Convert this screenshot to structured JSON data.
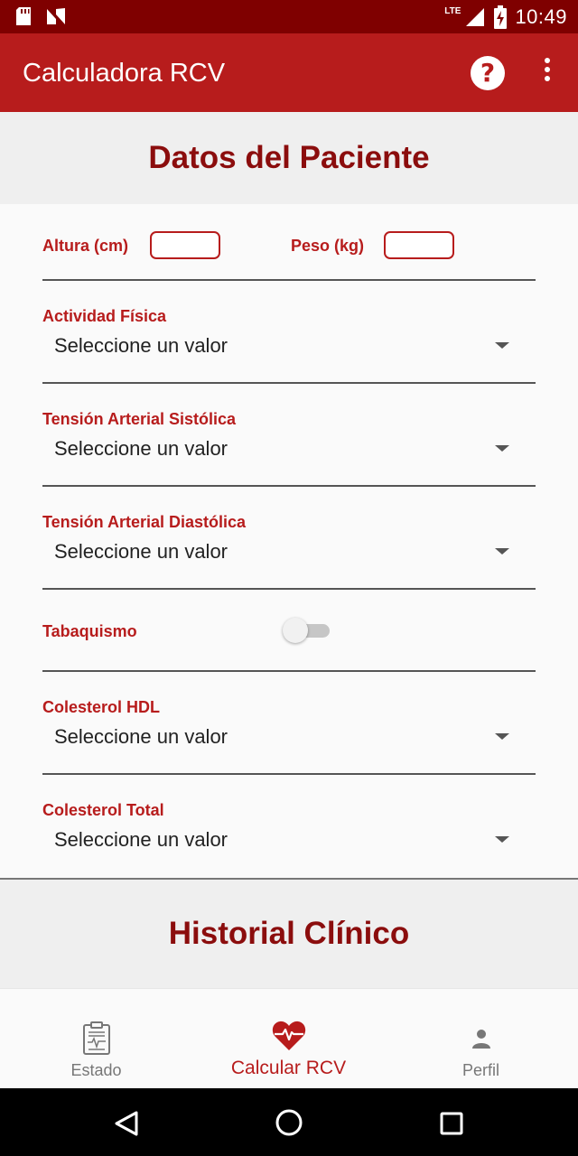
{
  "status_bar": {
    "time": "10:49",
    "network": "LTE",
    "icons": [
      "sd-card-icon",
      "notification-n-icon",
      "lte-signal-icon",
      "battery-charging-icon"
    ]
  },
  "app_bar": {
    "title": "Calculadora RCV",
    "help_icon": "help-circle-icon",
    "more_icon": "more-vert-icon"
  },
  "patient_section": {
    "title": "Datos del Paciente",
    "altura_label": "Altura (cm)",
    "altura_value": "",
    "peso_label": "Peso (kg)",
    "peso_value": "",
    "actividad_label": "Actividad Física",
    "actividad_value": "Seleccione un valor",
    "sistolica_label": "Tensión Arterial Sistólica",
    "sistolica_value": "Seleccione un valor",
    "diastolica_label": "Tensión Arterial Diastólica",
    "diastolica_value": "Seleccione un valor",
    "tabaquismo_label": "Tabaquismo",
    "tabaquismo_on": false,
    "hdl_label": "Colesterol HDL",
    "hdl_value": "Seleccione un valor",
    "total_label": "Colesterol Total",
    "total_value": "Seleccione un valor"
  },
  "history_section": {
    "title": "Historial Clínico"
  },
  "bottom_nav": {
    "estado_label": "Estado",
    "calcular_label": "Calcular RCV",
    "perfil_label": "Perfil",
    "active": "Calcular RCV",
    "active_color": "#b71c1c",
    "inactive_color": "#777777"
  },
  "colors": {
    "primary": "#b71c1c",
    "primary_dark": "#7f0000",
    "section_title": "#8b0d0d"
  }
}
